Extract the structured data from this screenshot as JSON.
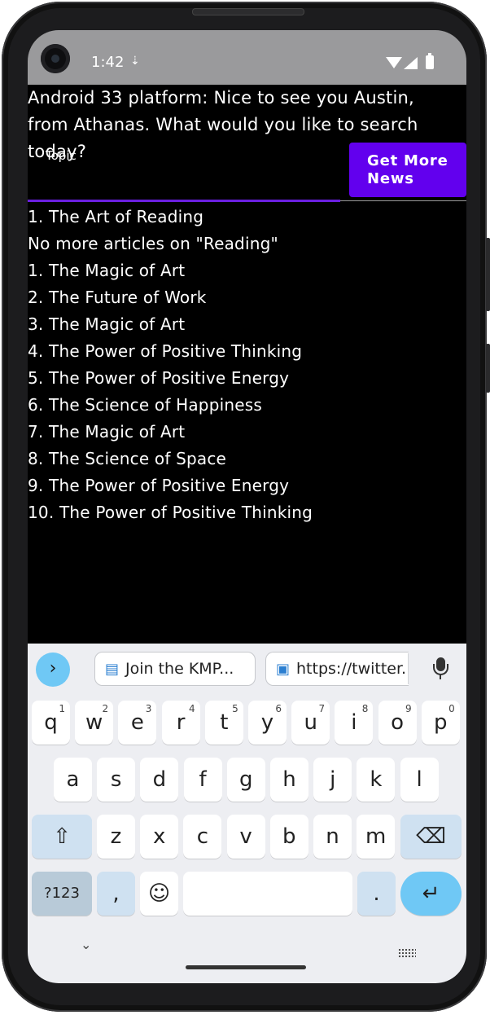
{
  "status_bar": {
    "time": "1:42"
  },
  "app": {
    "greeting": "Android 33 platform: Nice to see you Austin, from Athanas. What would you like to search today?",
    "topic_label": "Topic",
    "topic_value": "",
    "get_news_label": "Get More News",
    "articles": [
      "1. The Art of Reading",
      "No more articles on \"Reading\"",
      "1. The Magic of Art",
      "2. The Future of Work",
      "3. The Magic of Art",
      "4. The Power of Positive Thinking",
      "5. The Power of Positive Energy",
      "6. The Science of Happiness",
      "7. The Magic of Art",
      "8. The Science of Space",
      "9. The Power of Positive Energy",
      "10. The Power of Positive Thinking"
    ]
  },
  "keyboard": {
    "suggestions": [
      "Join the KMP...",
      "https://twitter..."
    ],
    "row1": [
      {
        "key": "q",
        "hint": "1"
      },
      {
        "key": "w",
        "hint": "2"
      },
      {
        "key": "e",
        "hint": "3"
      },
      {
        "key": "r",
        "hint": "4"
      },
      {
        "key": "t",
        "hint": "5"
      },
      {
        "key": "y",
        "hint": "6"
      },
      {
        "key": "u",
        "hint": "7"
      },
      {
        "key": "i",
        "hint": "8"
      },
      {
        "key": "o",
        "hint": "9"
      },
      {
        "key": "p",
        "hint": "0"
      }
    ],
    "row2": [
      "a",
      "s",
      "d",
      "f",
      "g",
      "h",
      "j",
      "k",
      "l"
    ],
    "row3": [
      "z",
      "x",
      "c",
      "v",
      "b",
      "n",
      "m"
    ],
    "num_key": "?123",
    "comma_key": ",",
    "emoji_key": "☺",
    "period_key": ".",
    "shift_key": "⇧",
    "backspace_key": "⌫",
    "enter_key": "↵",
    "expand_icon": "›"
  },
  "colors": {
    "accent": "#6200ee",
    "underline": "#6a1fe0",
    "keyboard_accent": "#6fc8f5"
  }
}
